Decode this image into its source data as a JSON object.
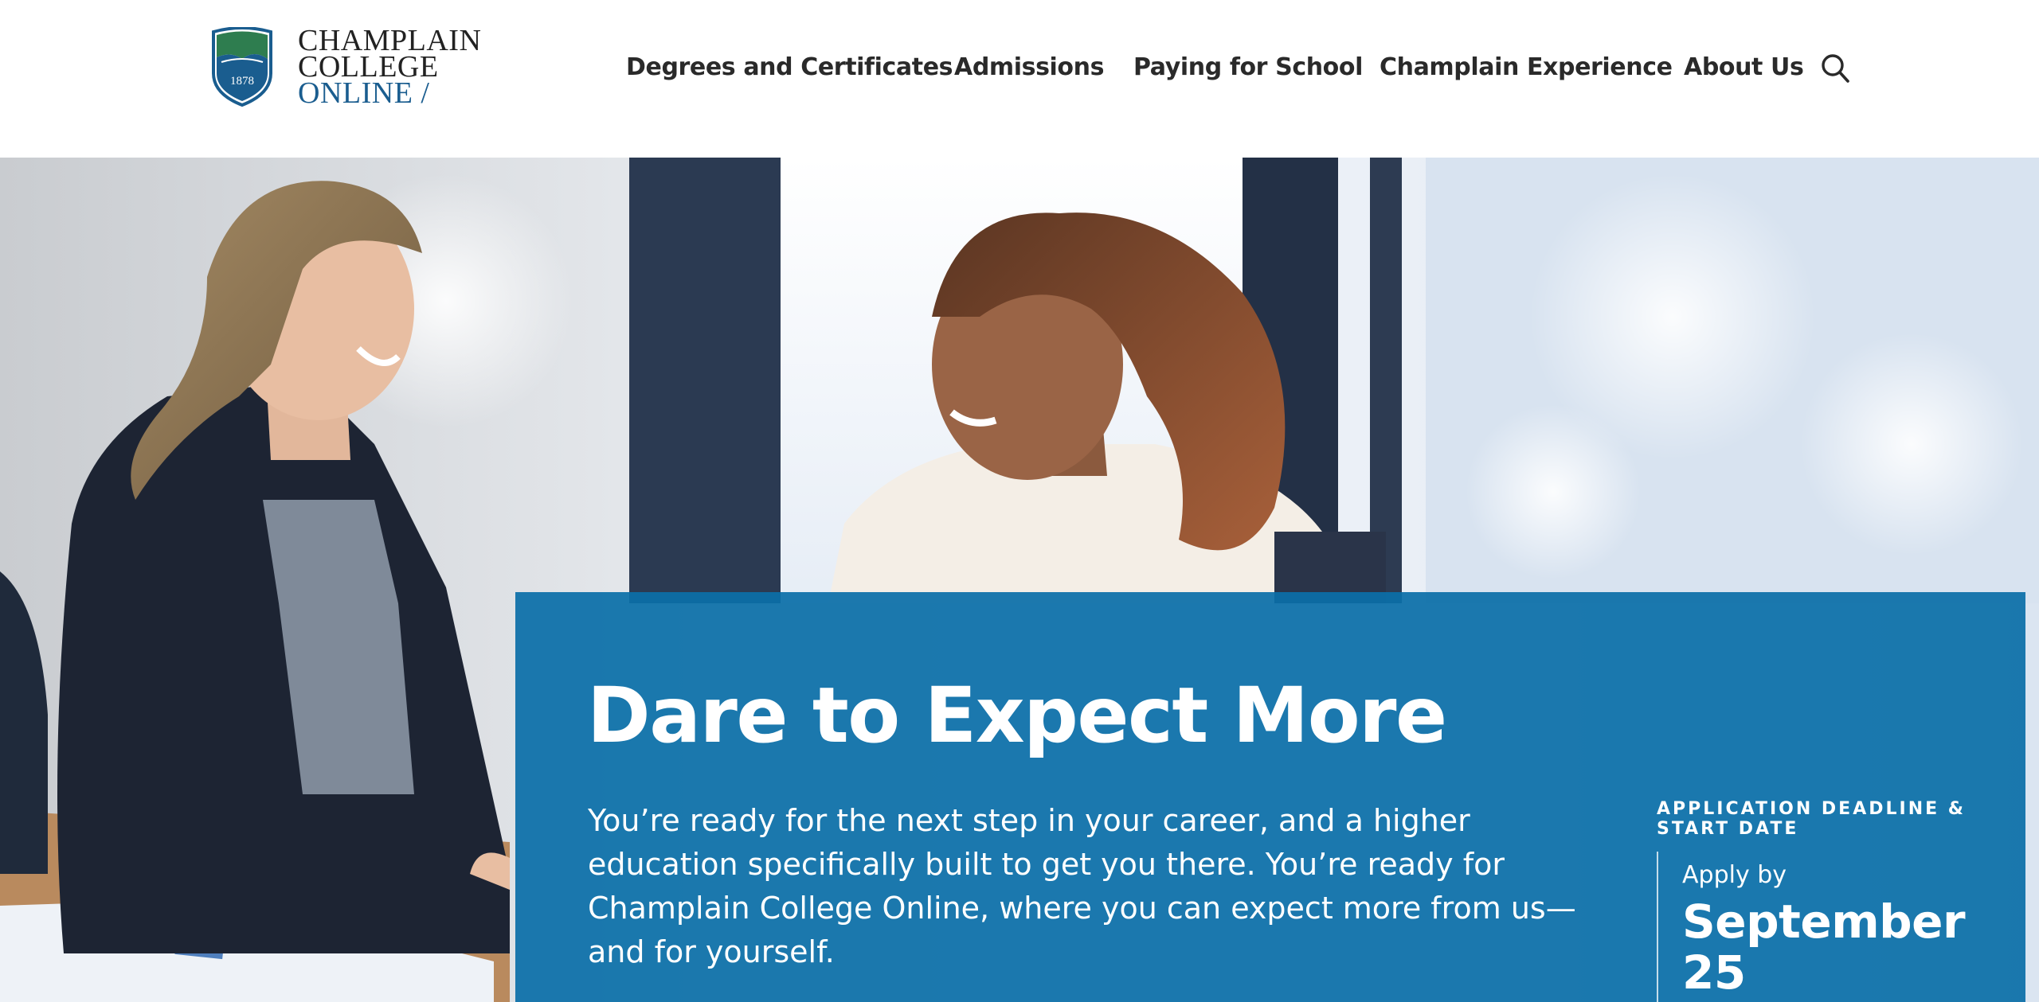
{
  "brand": {
    "line1": "CHAMPLAIN",
    "line2": "COLLEGE",
    "line3": "ONLINE /",
    "year": "1878",
    "shield_green": "#2e7d4f",
    "shield_blue": "#1a5d8f"
  },
  "nav": {
    "items": [
      "Degrees and Certificates",
      "Admissions",
      "Paying for School",
      "Champlain Experience",
      "About Us"
    ],
    "search_icon": "search-icon"
  },
  "hero": {
    "headline": "Dare to Expect More",
    "lede": "You’re ready for the next step in your career, and a higher education specifically built to get you there. You’re ready for Champlain College Online, where you can expect more from us—and for yourself.",
    "deadline": {
      "label": "APPLICATION DEADLINE & START DATE",
      "apply_by": "Apply by",
      "date": "September 25"
    },
    "panel_color": "#0b6fa8"
  }
}
